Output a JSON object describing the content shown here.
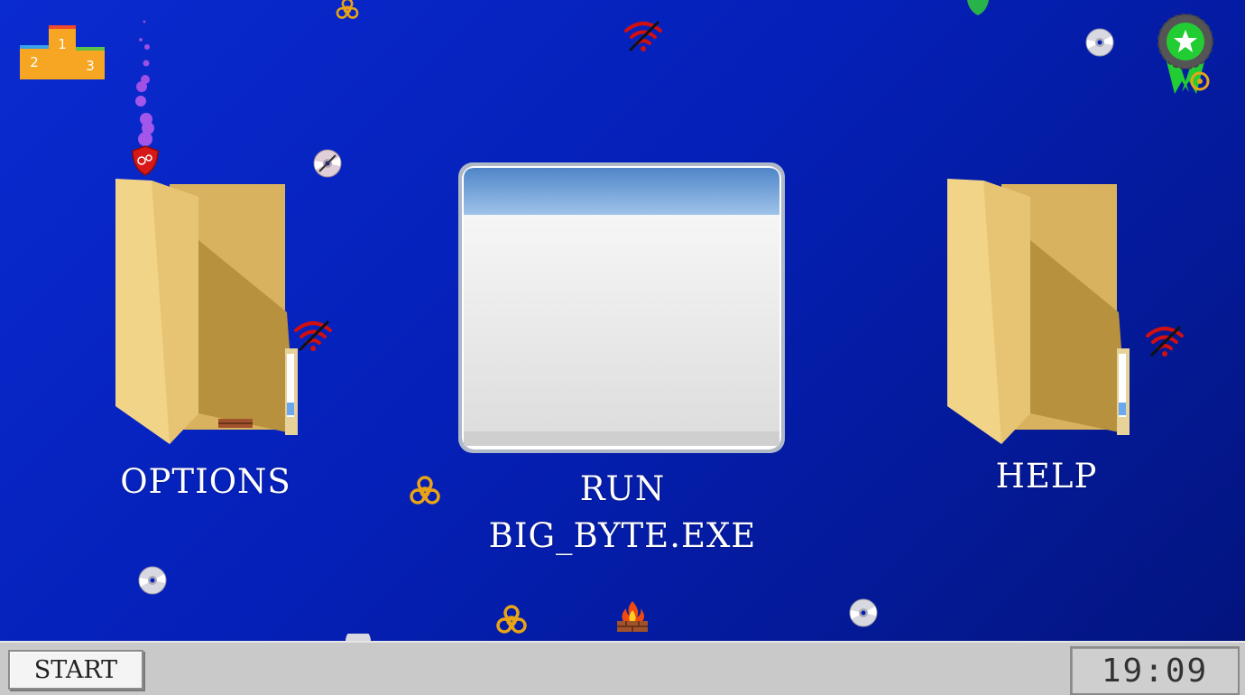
{
  "desktop": {
    "options_label": "OPTIONS",
    "run_label": "RUN\nBIG_BYTE.EXE",
    "help_label": "HELP",
    "leaderboard_icon": "podium-icon",
    "podium_places": [
      "2",
      "1",
      "3"
    ],
    "achievements_icon": "award-badge-icon"
  },
  "taskbar": {
    "start_label": "START",
    "clock_time": "19:09"
  },
  "colors": {
    "desktop_blue": "#0a2bd0",
    "taskbar_gray": "#c9c9c9",
    "folder_tan": "#e9c77b",
    "wifi_red": "#d01010",
    "biohazard_orange": "#e8a317",
    "award_green": "#22cc33"
  }
}
